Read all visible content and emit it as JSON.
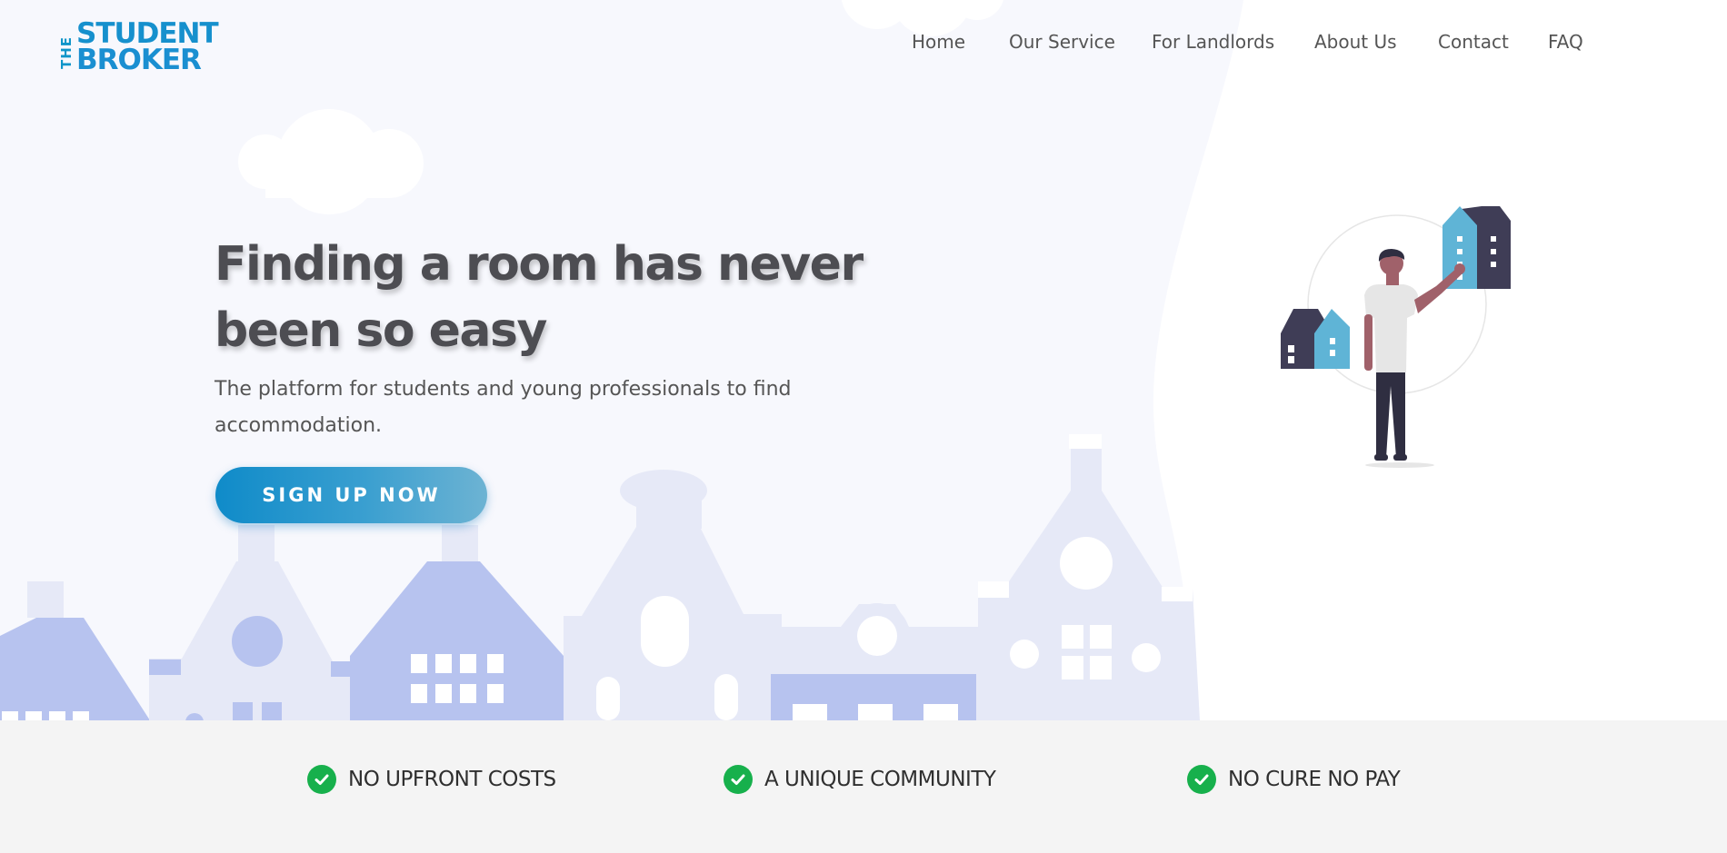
{
  "logo": {
    "vertical_text": "THE",
    "line1": "STUDENT",
    "line2": "BROKER",
    "alt": "THE STUDENT BROKER"
  },
  "nav": {
    "items": [
      "Home",
      "Our Service",
      "For Landlords",
      "About Us",
      "Contact",
      "FAQ"
    ]
  },
  "hero": {
    "headline_line1": "Finding a room has never",
    "headline_line2": "been so easy",
    "subline_line1": "The platform for students and young professionals to find",
    "subline_line2": "accommodation.",
    "cta_label": "SIGN UP NOW"
  },
  "features": [
    {
      "label": "NO UPFRONT COSTS",
      "icon": "check-circle-icon"
    },
    {
      "label": "A UNIQUE COMMUNITY",
      "icon": "check-circle-icon"
    },
    {
      "label": "NO CURE NO PAY",
      "icon": "check-circle-icon"
    }
  ],
  "colors": {
    "brand_blue": "#1690cd",
    "check_green": "#17b04c",
    "building_dark": "#3f3d56",
    "building_light": "#5fb4d6",
    "house_light": "#e6e9f7",
    "house_mid": "#b7c3ef"
  }
}
